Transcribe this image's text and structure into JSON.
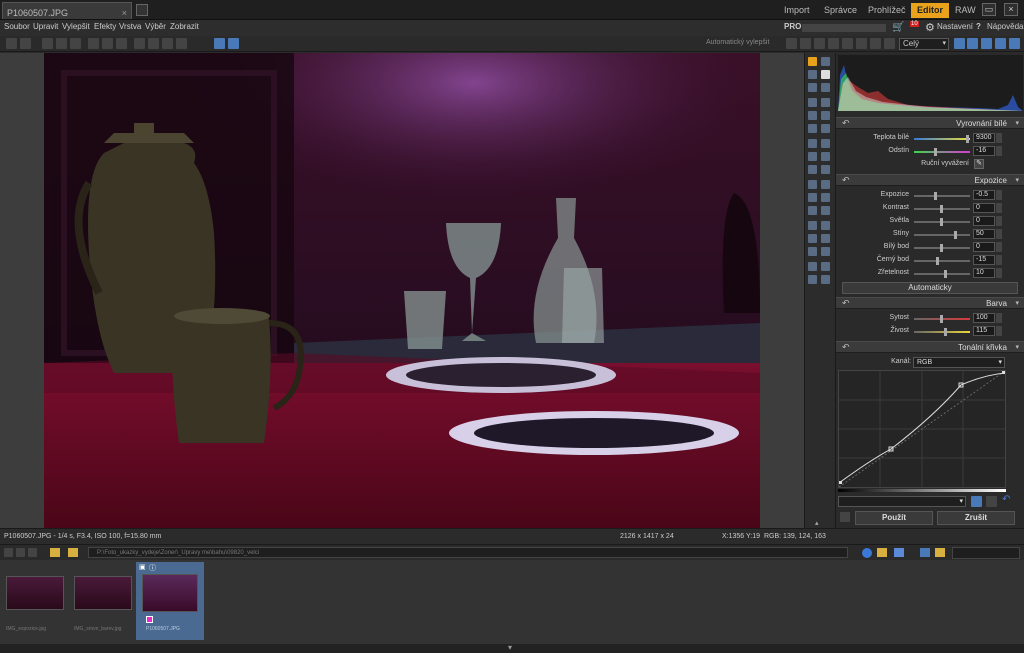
{
  "tab": {
    "title": "P1060507.JPG",
    "close": "×"
  },
  "modes": [
    "Import",
    "Správce",
    "Prohlížeč",
    "Editor",
    "RAW"
  ],
  "menu": [
    "Soubor",
    "Upravit",
    "Vylepšit",
    "Efekty",
    "Vrstva",
    "Výběr",
    "Zobrazit"
  ],
  "account": {
    "pro": "PRO",
    "notif_count": "10",
    "settings": "Nastavení",
    "help": "Nápověda"
  },
  "toolbar": {
    "auto_enhance": "Automatický vylepšit",
    "zoom": "Celý"
  },
  "status": {
    "file": "P1060507.JPG - 1/4 s, F3.4, ISO 100, f=15.80 mm",
    "dims": "2126 x 1417 x 24",
    "coords": "X:1356 Y:19",
    "rgb": "RGB: 139, 124, 163"
  },
  "path": "P:\\Foto_ukazky_vydeje\\Zoner\\_Upravy me\\bahu\\09820_velci",
  "thumbs": [
    {
      "name": "IMG_expozice.jpg"
    },
    {
      "name": "IMG_srovn_barev.jpg"
    },
    {
      "name": "P1060507.JPG"
    }
  ],
  "panel": {
    "white_balance": {
      "title": "Vyrovnání bílé",
      "rows": [
        {
          "label": "Teplota bílé",
          "value": "9300"
        },
        {
          "label": "Odstín",
          "value": "-16"
        }
      ],
      "manual": "Ruční vyvážení"
    },
    "exposure": {
      "title": "Expozice",
      "rows": [
        {
          "label": "Expozice",
          "value": "-0.5"
        },
        {
          "label": "Kontrast",
          "value": "0"
        },
        {
          "label": "Světla",
          "value": "0"
        },
        {
          "label": "Stíny",
          "value": "50"
        },
        {
          "label": "Bílý bod",
          "value": "0"
        },
        {
          "label": "Černý bod",
          "value": "-15"
        },
        {
          "label": "Zřetelnost",
          "value": "10"
        }
      ],
      "auto": "Automaticky"
    },
    "color": {
      "title": "Barva",
      "rows": [
        {
          "label": "Sytost",
          "value": "100"
        },
        {
          "label": "Živost",
          "value": "115"
        }
      ]
    },
    "curve": {
      "title": "Tonální křivka",
      "channel_label": "Kanál:",
      "channel": "RGB"
    },
    "apply": "Použít",
    "cancel": "Zrušit"
  }
}
